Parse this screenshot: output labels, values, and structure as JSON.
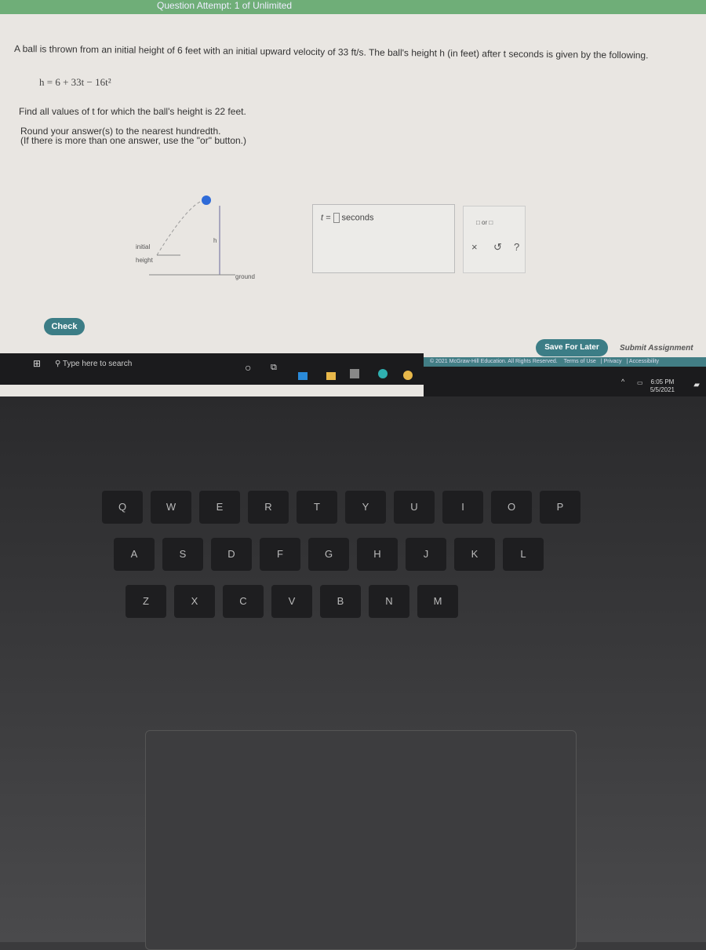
{
  "header": {
    "attempt": "Question Attempt: 1 of Unlimited"
  },
  "question": {
    "text": "A ball is thrown from an initial height of 6 feet with an initial upward velocity of 33 ft/s. The ball's height h (in feet) after t seconds is given by the following.",
    "formula": "h = 6 + 33t − 16t²",
    "find": "Find all values of t for which the ball's height is 22 feet.",
    "round1": "Round your answer(s) to the nearest hundredth.",
    "round2": "(If there is more than one answer, use the \"or\" button.)"
  },
  "diagram": {
    "initial": "initial",
    "height": "height",
    "h": "h",
    "ground": "ground"
  },
  "answer": {
    "prefix": "t =",
    "unit": "seconds"
  },
  "tools": {
    "or": "□ or □",
    "clear": "×",
    "undo": "↺",
    "help": "?"
  },
  "buttons": {
    "check": "Check",
    "save": "Save For Later",
    "submit": "Submit Assignment"
  },
  "footer": {
    "copyright": "© 2021 McGraw-Hill Education. All Rights Reserved.",
    "terms": "Terms of Use",
    "privacy": "Privacy",
    "accessibility": "Accessibility"
  },
  "taskbar": {
    "search": "Type here to search",
    "time": "6:05 PM",
    "date": "5/5/2021"
  },
  "keyboard": {
    "row1": [
      "Q",
      "W",
      "E",
      "R",
      "T",
      "Y",
      "U",
      "I",
      "O",
      "P"
    ],
    "row2": [
      "A",
      "S",
      "D",
      "F",
      "G",
      "H",
      "J",
      "K",
      "L"
    ],
    "row3": [
      "Z",
      "X",
      "C",
      "V",
      "B",
      "N",
      "M"
    ]
  }
}
